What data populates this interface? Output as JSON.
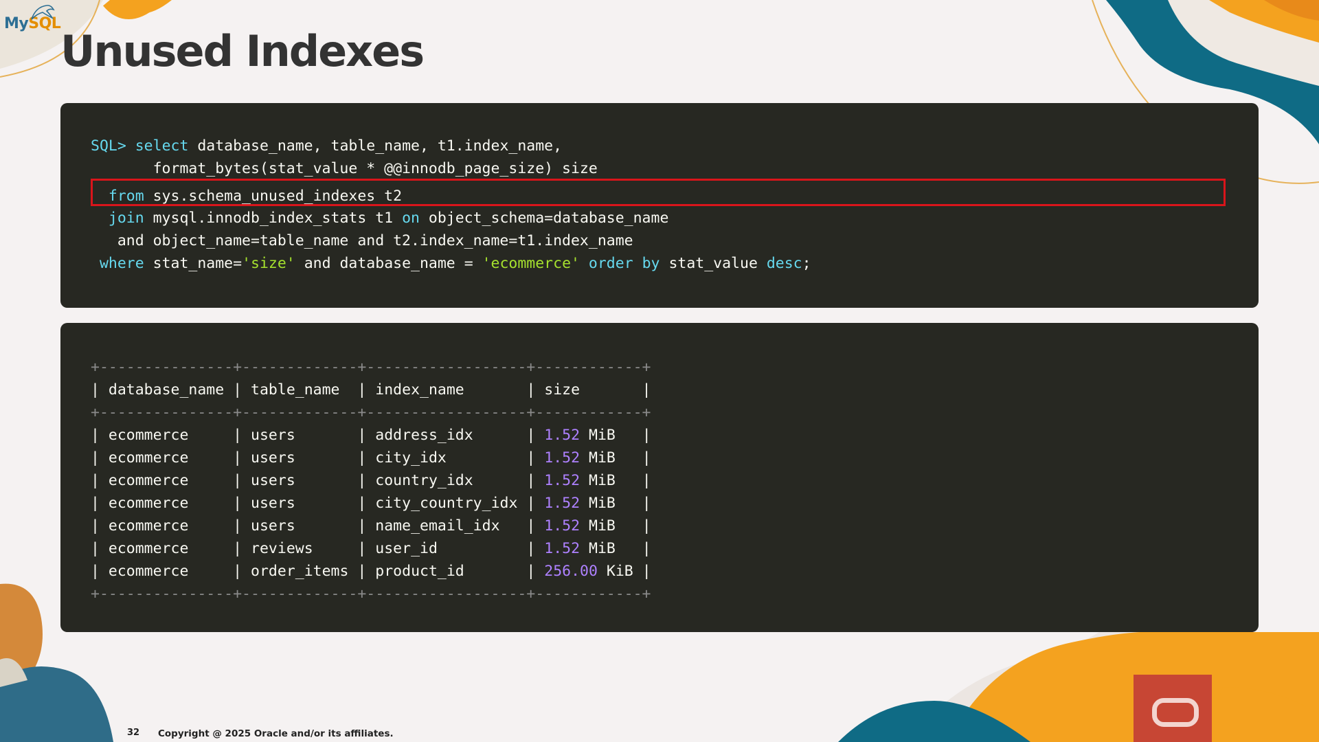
{
  "brand": {
    "logo_text_main": "My",
    "logo_text_accent": "SQL"
  },
  "slide": {
    "title": "Unused Indexes",
    "page_number": "32",
    "copyright": "Copyright @ 2025 Oracle and/or its affiliates."
  },
  "query": {
    "lines": [
      [
        {
          "t": "SQL> ",
          "c": "kw-prompt"
        },
        {
          "t": "select",
          "c": "kw"
        },
        {
          "t": " database_name, table_name, t1.index_name,",
          "c": ""
        }
      ],
      [
        {
          "t": "       format_bytes(stat_value * @@innodb_page_size) size",
          "c": ""
        }
      ],
      [
        {
          "t": "  ",
          "c": ""
        },
        {
          "t": "from",
          "c": "kw"
        },
        {
          "t": " sys.schema_unused_indexes t2",
          "c": ""
        }
      ],
      [
        {
          "t": "  ",
          "c": ""
        },
        {
          "t": "join",
          "c": "kw"
        },
        {
          "t": " mysql.innodb_index_stats t1 ",
          "c": ""
        },
        {
          "t": "on",
          "c": "kw"
        },
        {
          "t": " object_schema=database_name",
          "c": ""
        }
      ],
      [
        {
          "t": "   and object_name=table_name and t2.index_name=t1.index_name",
          "c": ""
        }
      ],
      [
        {
          "t": " ",
          "c": ""
        },
        {
          "t": "where",
          "c": "kw"
        },
        {
          "t": " stat_name=",
          "c": ""
        },
        {
          "t": "'size'",
          "c": "str"
        },
        {
          "t": " and database_name = ",
          "c": ""
        },
        {
          "t": "'ecommerce'",
          "c": "str"
        },
        {
          "t": " ",
          "c": ""
        },
        {
          "t": "order",
          "c": "kw"
        },
        {
          "t": " ",
          "c": ""
        },
        {
          "t": "by",
          "c": "kw"
        },
        {
          "t": " stat_value ",
          "c": ""
        },
        {
          "t": "desc",
          "c": "kw"
        },
        {
          "t": ";",
          "c": ""
        }
      ]
    ],
    "highlighted_line_index": 2,
    "highlight_color": "#d9151b"
  },
  "result": {
    "border_line": "+---------------+-------------+------------------+------------+",
    "headers": [
      "database_name",
      "table_name",
      "index_name",
      "size"
    ],
    "rows": [
      [
        "ecommerce",
        "users",
        "address_idx",
        "1.52",
        "MiB"
      ],
      [
        "ecommerce",
        "users",
        "city_idx",
        "1.52",
        "MiB"
      ],
      [
        "ecommerce",
        "users",
        "country_idx",
        "1.52",
        "MiB"
      ],
      [
        "ecommerce",
        "users",
        "city_country_idx",
        "1.52",
        "MiB"
      ],
      [
        "ecommerce",
        "users",
        "name_email_idx",
        "1.52",
        "MiB"
      ],
      [
        "ecommerce",
        "reviews",
        "user_id",
        "1.52",
        "MiB"
      ],
      [
        "ecommerce",
        "order_items",
        "product_id",
        "256.00",
        "KiB"
      ]
    ]
  },
  "colors": {
    "code_background": "#272822",
    "keyword": "#66d9ef",
    "string": "#a6e22e",
    "number": "#ae81ff",
    "text": "#f8f8f2",
    "oracle_red": "#c74634",
    "teal": "#0f6b85",
    "orange": "#f4a21f"
  }
}
